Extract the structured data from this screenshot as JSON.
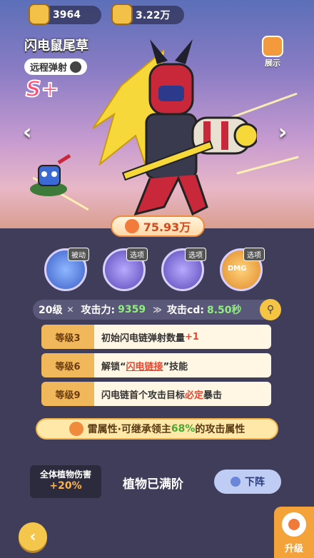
{
  "top": {
    "coins": "3964",
    "scrolls": "3.22万"
  },
  "plant": {
    "name": "闪电鼠尾草",
    "type_tag": "远程弹射",
    "rank": "S+",
    "power": "75.93万"
  },
  "show_label": "展示",
  "skills": [
    {
      "label": "被动",
      "color": "#5b8ef5"
    },
    {
      "label": "选项",
      "color": "#7a6ad6"
    },
    {
      "label": "选项",
      "color": "#7a6ad6"
    },
    {
      "label": "选项",
      "color": "#f2a23a",
      "text": "DMG"
    }
  ],
  "stats": {
    "level": "20级",
    "atk_label": "攻击力:",
    "atk": "9359",
    "cd_label": "攻击cd:",
    "cd": "8.50秒"
  },
  "levels": [
    {
      "key": "等级3",
      "pre": "初始闪电链弹射数量",
      "hl": "+1",
      "post": ""
    },
    {
      "key": "等级6",
      "pre": "解锁“",
      "hl": "闪电链接",
      "post": "”技能"
    },
    {
      "key": "等级9",
      "pre": "闪电链首个攻击目标",
      "hl": "必定",
      "post": "暴击"
    }
  ],
  "attr": {
    "pre": "雷属性·可继承领主",
    "hl": "68%",
    "post": "的攻击属性"
  },
  "damage": {
    "label": "全体植物伤害",
    "value": "+20%"
  },
  "maxed": "植物已满阶",
  "down_label": "下阵",
  "upgrade_label": "升级"
}
